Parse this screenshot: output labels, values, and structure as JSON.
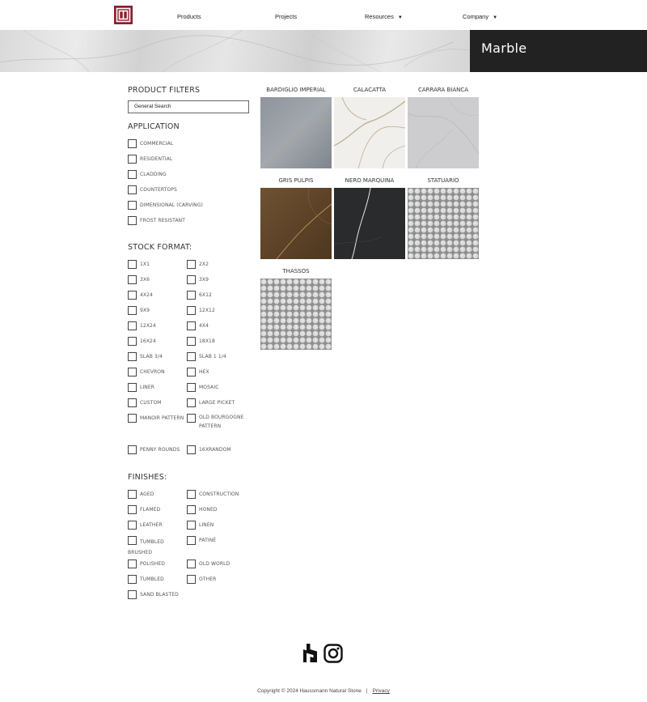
{
  "header": {
    "nav": [
      {
        "label": "Products",
        "has_caret": false
      },
      {
        "label": "Projects",
        "has_caret": false
      },
      {
        "label": "Resources",
        "has_caret": true
      },
      {
        "label": "Company",
        "has_caret": true
      }
    ],
    "caret": "▼",
    "logo_color": "#8c1d2c"
  },
  "hero": {
    "title": "Marble"
  },
  "filters": {
    "title": "PRODUCT FILTERS",
    "search_placeholder": "General Search",
    "application": {
      "title": "APPLICATION",
      "options": [
        "COMMERCIAL",
        "RESIDENTIAL",
        "CLADDING",
        "COUNTERTOPS",
        "DIMENSIONAL (CARVING)",
        "FROST RESISTANT"
      ]
    },
    "stock_format": {
      "title": "STOCK FORMAT:",
      "options": [
        "1X1",
        "2X2",
        "3X6",
        "3X9",
        "4X24",
        "6X12",
        "9X9",
        "12X12",
        "12X24",
        "4X4",
        "16X24",
        "18X18",
        "SLAB 3/4",
        "SLAB 1 1/4",
        "CHEVRON",
        "HEX",
        "LINER",
        "MOSAIC",
        "CUSTOM",
        "LARGE PICKET",
        "MANOIR PATTERN",
        "OLD BOURGOGNE PATTERN",
        "PENNY ROUNDS",
        "16XRANDOM"
      ]
    },
    "finishes": {
      "title": "FINISHES:",
      "options": [
        "AGED",
        "CONSTRUCTION",
        "FLAMED",
        "HONED",
        "LEATHER",
        "LINEN",
        "TUMBLED BRUSHED",
        "PATINÉ",
        "POLISHED",
        "OLD WORLD",
        "TUMBLED",
        "OTHER",
        "SAND BLASTED"
      ]
    }
  },
  "products": [
    {
      "name": "BARDIGLIO IMPERIAL"
    },
    {
      "name": "CALACATTA"
    },
    {
      "name": "CARRARA BIANCA"
    },
    {
      "name": "GRIS PULPIS"
    },
    {
      "name": "NERO MARQUINA"
    },
    {
      "name": "STATUARIO"
    },
    {
      "name": "THASSOS"
    }
  ],
  "footer": {
    "social_icons": [
      "houzz-icon",
      "instagram-icon"
    ],
    "copyright": "Copyright © 2024 Haussmann Natural Stone",
    "separator": "|",
    "privacy": "Privacy"
  }
}
